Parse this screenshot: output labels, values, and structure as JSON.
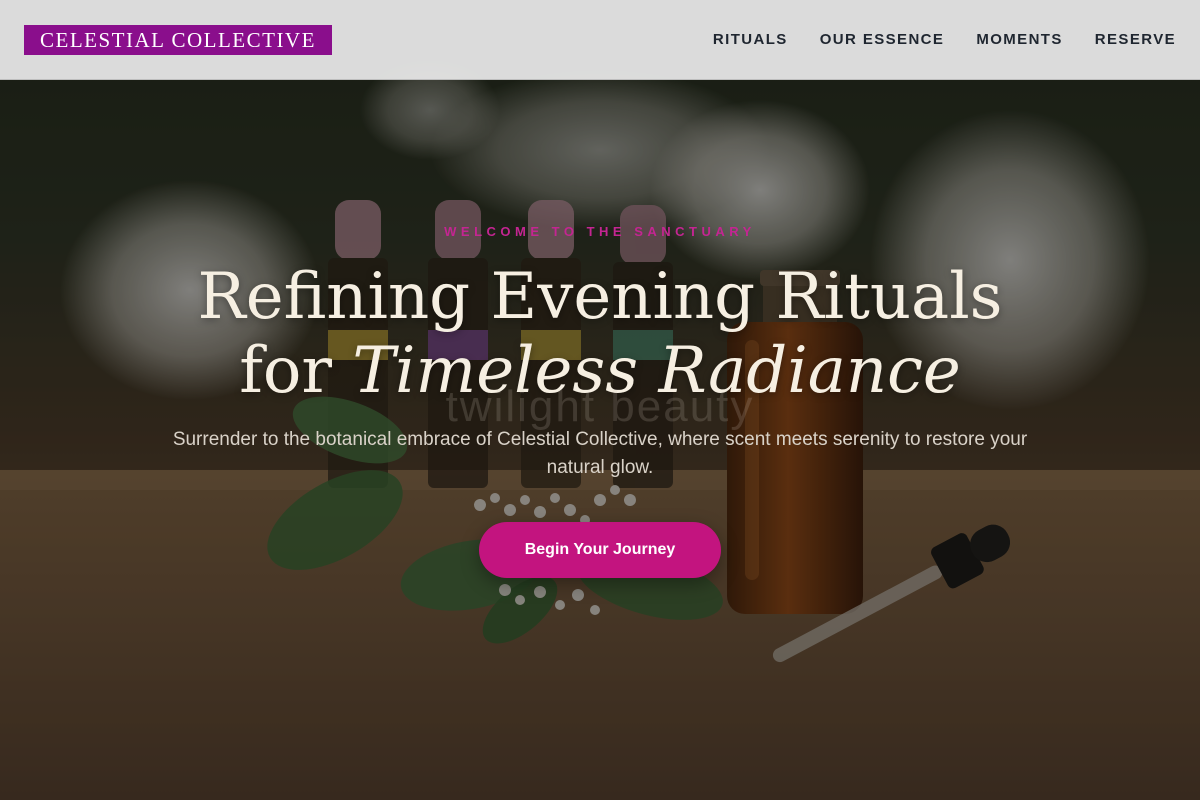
{
  "header": {
    "brand": "CELESTIAL COLLECTIVE",
    "nav": [
      {
        "label": "RITUALS"
      },
      {
        "label": "OUR ESSENCE"
      },
      {
        "label": "MOMENTS"
      },
      {
        "label": "RESERVE"
      }
    ]
  },
  "hero": {
    "eyebrow": "WELCOME TO THE SANCTUARY",
    "headline_line1": "Refining Evening Rituals",
    "headline_line2_prefix": "for ",
    "headline_line2_emphasis": "Timeless Radiance",
    "ghost_text": "twilight beauty",
    "subtext": "Surrender to the botanical embrace of Celestial Collective, where scent meets serenity to restore your natural glow.",
    "cta_label": "Begin Your Journey"
  },
  "colors": {
    "brand_bg": "#8a0e8c",
    "accent": "#c3147f",
    "eyebrow": "#c42592",
    "headline": "#f6efe2"
  }
}
